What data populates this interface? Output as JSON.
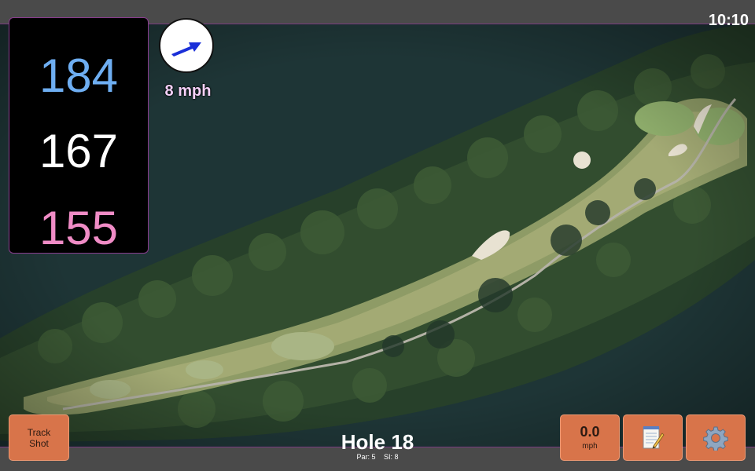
{
  "clock": {
    "time": "10:10"
  },
  "distances": {
    "back": "184",
    "center": "167",
    "front": "155",
    "colors": {
      "back": "#6eaef2",
      "center": "#ffffff",
      "front": "#f08cc6"
    }
  },
  "wind": {
    "speed_label": "8 mph",
    "icon": "wind-direction-arrow-icon",
    "arrow_color": "#1a2fd8"
  },
  "track_shot": {
    "line1": "Track",
    "line2": "Shot"
  },
  "hole": {
    "title": "Hole 18",
    "par_label": "Par: 5",
    "si_label": "SI: 8"
  },
  "speed": {
    "value": "0.0",
    "unit": "mph"
  },
  "toolbar": {
    "notes_icon": "notepad-icon",
    "settings_icon": "gear-icon",
    "accent": "#d8744a"
  },
  "map": {
    "icon": "aerial-hole-map"
  }
}
